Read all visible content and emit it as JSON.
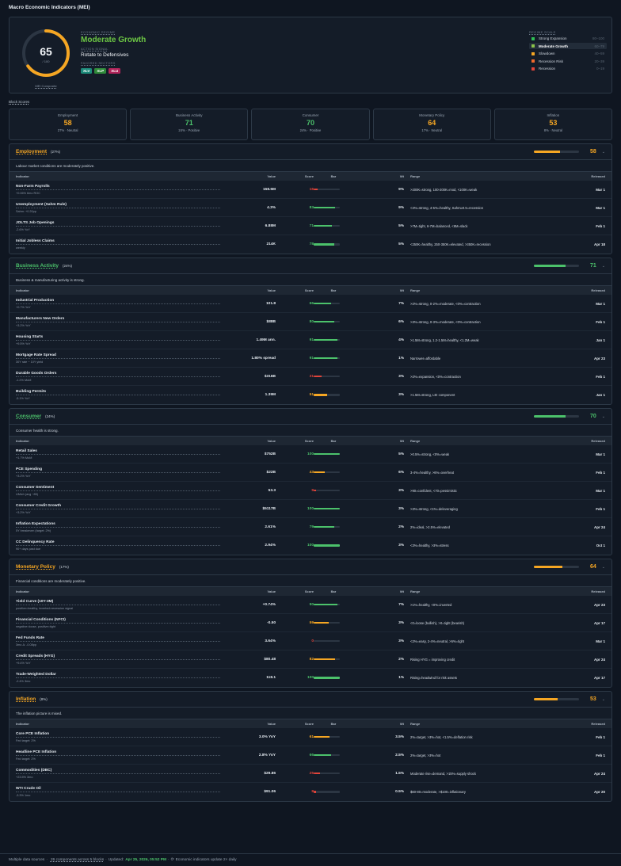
{
  "app": {
    "title": "Macro Economic Indicators (MEI)"
  },
  "hero": {
    "score": "65",
    "score_sub": "/ 100",
    "score_label": "MEI Composite",
    "score_fraction": 0.65,
    "regime_label": "ECONOMIC REGIME",
    "regime": "Moderate Growth",
    "signal_label": "ACTION SIGNAL",
    "signal": "Rotate to Defensives",
    "sectors_label": "FAVORED SECTORS",
    "sectors": [
      {
        "t": "XLV",
        "c": "#1c8a7a"
      },
      {
        "t": "XLP",
        "c": "#2f8a3a"
      },
      {
        "t": "XLU",
        "c": "#b0245a"
      }
    ],
    "scale_label": "REGIME SCALE",
    "scale": [
      {
        "name": "Strong Expansion",
        "range": "80–100",
        "color": "#2fbf54",
        "active": false
      },
      {
        "name": "Moderate Growth",
        "range": "60–79",
        "color": "#8bc34a",
        "active": true
      },
      {
        "name": "Slowdown",
        "range": "40–59",
        "color": "#f5a623",
        "active": false
      },
      {
        "name": "Recession Risk",
        "range": "20–39",
        "color": "#f06a2c",
        "active": false
      },
      {
        "name": "Recession",
        "range": "0–19",
        "color": "#e0443a",
        "active": false
      }
    ]
  },
  "block_scores_label": "Block Scores",
  "cards": [
    {
      "name": "Employment",
      "value": "58",
      "meta": "27% · Neutral",
      "color": "#f5a623"
    },
    {
      "name": "Business Activity",
      "value": "71",
      "meta": "24% · Positive",
      "color": "#4cc26b"
    },
    {
      "name": "Consumer",
      "value": "70",
      "meta": "24% · Positive",
      "color": "#4cc26b"
    },
    {
      "name": "Monetary Policy",
      "value": "64",
      "meta": "17% · Neutral",
      "color": "#f5a623"
    },
    {
      "name": "Inflation",
      "value": "53",
      "meta": "8% · Neutral",
      "color": "#f5a623"
    }
  ],
  "table_headers": {
    "indicator": "Indicator",
    "value": "Value",
    "score": "Score",
    "bar": "Bar",
    "wt": "Wt",
    "range": "Range",
    "released": "Released"
  },
  "blocks": [
    {
      "name": "Employment",
      "weight": "(27%)",
      "score": "58",
      "frac": 0.58,
      "color": "#f5a623",
      "desc": "Labour market conditions are moderately positive.",
      "chev": "⌄",
      "rows": [
        {
          "name": "Non-Farm Payrolls",
          "sub": "+0.06% 6mo ROC",
          "value": "158.6M",
          "score": "16",
          "frac": 0.16,
          "color": "#e0443a",
          "wt": "9%",
          "range": ">200K=strong, 100-200K=mod, <100K=weak",
          "released": "Mar 1"
        },
        {
          "name": "Unemployment (Sahm Rule)",
          "sub": "Sahm: +0.20pp",
          "value": "4.3%",
          "score": "83",
          "frac": 0.83,
          "color": "#4cc26b",
          "wt": "9%",
          "range": "<4%=strong, 4-5%=healthy, Sahm≥0.5=recession",
          "released": "Mar 1"
        },
        {
          "name": "JOLTS Job Openings",
          "sub": "-2.6% YoY",
          "value": "6.88M",
          "score": "71",
          "frac": 0.71,
          "color": "#4cc26b",
          "wt": "5%",
          "range": ">7M=tight, 6-7M=balanced, <6M=slack",
          "released": "Feb 1"
        },
        {
          "name": "Initial Jobless Claims",
          "sub": "weekly",
          "value": "214K",
          "score": "78",
          "frac": 0.78,
          "color": "#4cc26b",
          "wt": "5%",
          "range": "<250K=healthy, 250-350K=elevated, >350K=recession",
          "released": "Apr 18"
        }
      ]
    },
    {
      "name": "Business Activity",
      "weight": "(24%)",
      "score": "71",
      "frac": 0.71,
      "color": "#4cc26b",
      "desc": "Business & manufacturing activity is strong.",
      "chev": "⌄",
      "rows": [
        {
          "name": "Industrial Production",
          "sub": "+0.7% YoY",
          "value": "101.8",
          "score": "66",
          "frac": 0.66,
          "color": "#4cc26b",
          "wt": "7%",
          "range": ">2%=strong, 0-2%=moderate, <0%=contraction",
          "released": "Mar 1"
        },
        {
          "name": "Manufacturers New Orders",
          "sub": "+3.2% YoY",
          "value": "$88B",
          "score": "80",
          "frac": 0.8,
          "color": "#4cc26b",
          "wt": "6%",
          "range": ">3%=strong, 0-3%=moderate, <0%=contraction",
          "released": "Feb 1"
        },
        {
          "name": "Housing Starts",
          "sub": "+9.5% YoY",
          "value": "1.49M ann.",
          "score": "91",
          "frac": 0.91,
          "color": "#4cc26b",
          "wt": "4%",
          "range": ">1.5M=strong, 1.2-1.5M=healthy, <1.2M=weak",
          "released": "Jan 1"
        },
        {
          "name": "Mortgage Rate Spread",
          "sub": "30Y rate − 10Y yield",
          "value": "1.80% spread",
          "score": "91",
          "frac": 0.91,
          "color": "#4cc26b",
          "wt": "1%",
          "range": "Narrower=affordable",
          "released": "Apr 23"
        },
        {
          "name": "Durable Goods Orders",
          "sub": "-1.2% MoM",
          "value": "$316B",
          "score": "31",
          "frac": 0.31,
          "color": "#e0443a",
          "wt": "3%",
          "range": ">2%=expansion, <0%=contraction",
          "released": "Feb 1"
        },
        {
          "name": "Building Permits",
          "sub": "-5.1% YoY",
          "value": "1.39M",
          "score": "51",
          "frac": 0.51,
          "color": "#f5a623",
          "wt": "3%",
          "range": ">1.5M=strong, LEI component",
          "released": "Jan 1"
        }
      ]
    },
    {
      "name": "Consumer",
      "weight": "(24%)",
      "score": "70",
      "frac": 0.7,
      "color": "#4cc26b",
      "desc": "Consumer health is strong.",
      "chev": "⌄",
      "rows": [
        {
          "name": "Retail Sales",
          "sub": "+1.7% MoM",
          "value": "$752B",
          "score": "100",
          "frac": 1.0,
          "color": "#4cc26b",
          "wt": "5%",
          "range": ">0.5%=strong, <0%=weak",
          "released": "Mar 1"
        },
        {
          "name": "PCE Spending",
          "sub": "+3.2% YoY",
          "value": "$22B",
          "score": "43",
          "frac": 0.43,
          "color": "#f5a623",
          "wt": "6%",
          "range": "3-4%=healthy, >6%=overheat",
          "released": "Feb 1"
        },
        {
          "name": "Consumer Sentiment",
          "sub": "UMich (avg ~85)",
          "value": "53.3",
          "score": "9",
          "frac": 0.09,
          "color": "#e0443a",
          "wt": "3%",
          "range": ">90=confident, <70=pessimistic",
          "released": "Mar 1"
        },
        {
          "name": "Consumer Credit Growth",
          "sub": "+3.2% YoY",
          "value": "$5117B",
          "score": "100",
          "frac": 1.0,
          "color": "#4cc26b",
          "wt": "3%",
          "range": ">3%=strong, <1%=deleveraging",
          "released": "Feb 1"
        },
        {
          "name": "Inflation Expectations",
          "sub": "5Y breakeven (target: 2%)",
          "value": "2.61%",
          "score": "79",
          "frac": 0.79,
          "color": "#4cc26b",
          "wt": "2%",
          "range": "2%=ideal, >2.5%=elevated",
          "released": "Apr 24"
        },
        {
          "name": "CC Delinquency Rate",
          "sub": "90+ days past due",
          "value": "2.94%",
          "score": "100",
          "frac": 1.0,
          "color": "#4cc26b",
          "wt": "3%",
          "range": "<3%=healthy, >3%=stress",
          "released": "Oct 1"
        }
      ]
    },
    {
      "name": "Monetary Policy",
      "weight": "(17%)",
      "score": "64",
      "frac": 0.64,
      "color": "#f5a623",
      "desc": "Financial conditions are moderately positive.",
      "chev": "⌄",
      "rows": [
        {
          "name": "Yield Curve (10Y-3M)",
          "sub": "positive=healthy, inverted=recession signal",
          "value": "+0.74%",
          "score": "90",
          "frac": 0.9,
          "color": "#4cc26b",
          "wt": "7%",
          "range": ">1%=healthy, <0%=inverted",
          "released": "Apr 23"
        },
        {
          "name": "Financial Conditions (NFCI)",
          "sub": "negative=loose, positive=tight",
          "value": "-0.50",
          "score": "59",
          "frac": 0.59,
          "color": "#f5a623",
          "wt": "3%",
          "range": "<0=loose (bullish), >0=tight (bearish)",
          "released": "Apr 17"
        },
        {
          "name": "Fed Funds Rate",
          "sub": "3mo Δ: -0.08pp",
          "value": "3.64%",
          "score": "0",
          "frac": 0.0,
          "color": "#e0443a",
          "wt": "3%",
          "range": "<2%=easy, 2-4%=neutral, >5%=tight",
          "released": "Mar 1"
        },
        {
          "name": "Credit Spreads (HYG)",
          "sub": "+9.4% YoY",
          "value": "$80.48",
          "score": "82",
          "frac": 0.82,
          "color": "#f5a623",
          "wt": "2%",
          "range": "Rising HYG = improving credit",
          "released": "Apr 24"
        },
        {
          "name": "Trade-Weighted Dollar",
          "sub": "-2.4% 3mo",
          "value": "118.1",
          "score": "100",
          "frac": 1.0,
          "color": "#4cc26b",
          "wt": "1%",
          "range": "Rising=headwind for risk assets",
          "released": "Apr 17"
        }
      ]
    },
    {
      "name": "Inflation",
      "weight": "(8%)",
      "score": "53",
      "frac": 0.53,
      "color": "#f5a623",
      "desc": "The inflation picture is mixed.",
      "chev": "⌄",
      "rows": [
        {
          "name": "Core PCE Inflation",
          "sub": "Fed target: 2%",
          "value": "3.0% YoY",
          "score": "61",
          "frac": 0.61,
          "color": "#f5a623",
          "wt": "3.5%",
          "range": "2%=target, >3%=hot, <1.5%=deflation risk",
          "released": "Feb 1"
        },
        {
          "name": "Headline PCE Inflation",
          "sub": "Fed target: 2%",
          "value": "2.8% YoY",
          "score": "66",
          "frac": 0.66,
          "color": "#4cc26b",
          "wt": "2.5%",
          "range": "2%=target, >3%=hot",
          "released": "Feb 1"
        },
        {
          "name": "Commodities (DBC)",
          "sub": "+23.5% 3mo",
          "value": "$29.86",
          "score": "25",
          "frac": 0.25,
          "color": "#e0443a",
          "wt": "1.5%",
          "range": "Moderate rise=demand, >15%=supply shock",
          "released": "Apr 24"
        },
        {
          "name": "WTI Crude Oil",
          "sub": "-3.3% 1mo",
          "value": "$91.06",
          "score": "8",
          "frac": 0.08,
          "color": "#e0443a",
          "wt": "0.5%",
          "range": "$60-80=moderate, >$100=inflationary",
          "released": "Apr 20"
        }
      ]
    }
  ],
  "footer": {
    "sources": "Multiple data sources",
    "components": "26 components across 5 blocks",
    "updated_label": "Updated:",
    "updated": "Apr 25, 2026, 05:52 PM",
    "note": "Economic indicators update 2× daily"
  }
}
